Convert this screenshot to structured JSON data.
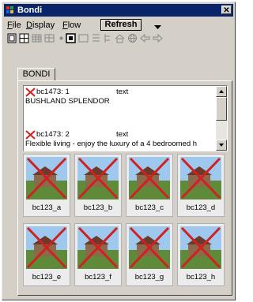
{
  "window": {
    "title": "Bondi",
    "close_label": "✕"
  },
  "menubar": {
    "items": [
      "File",
      "Display",
      "Flow"
    ],
    "refresh_label": "Refresh",
    "chevron": "▼"
  },
  "toolbar": {
    "icons": [
      "page-icon",
      "split-icon",
      "grid-icon",
      "table-icon",
      "dot-icon",
      "select-icon",
      "frame-icon",
      "list-icon",
      "tree-icon",
      "home-icon",
      "globe-icon",
      "back-icon",
      "forward-icon"
    ]
  },
  "tab": {
    "label": "BONDI"
  },
  "list": {
    "entries": [
      {
        "id": "bc1473:",
        "num": "1",
        "kind": "text",
        "desc": "BUSHLAND SPLENDOR"
      },
      {
        "id": "bc1473:",
        "num": "2",
        "kind": "text",
        "desc": "Flexible living - enjoy the luxury of a 4 bedroomed h"
      }
    ]
  },
  "thumbnails": [
    {
      "caption": "bc123_a"
    },
    {
      "caption": "bc123_b"
    },
    {
      "caption": "bc123_c"
    },
    {
      "caption": "bc123_d"
    },
    {
      "caption": "bc123_e"
    },
    {
      "caption": "bc123_f"
    },
    {
      "caption": "bc123_g"
    },
    {
      "caption": "bc123_h"
    }
  ],
  "colors": {
    "titlebar": "#0a246a",
    "cross": "#d02020",
    "window": "#d4d0c8"
  }
}
